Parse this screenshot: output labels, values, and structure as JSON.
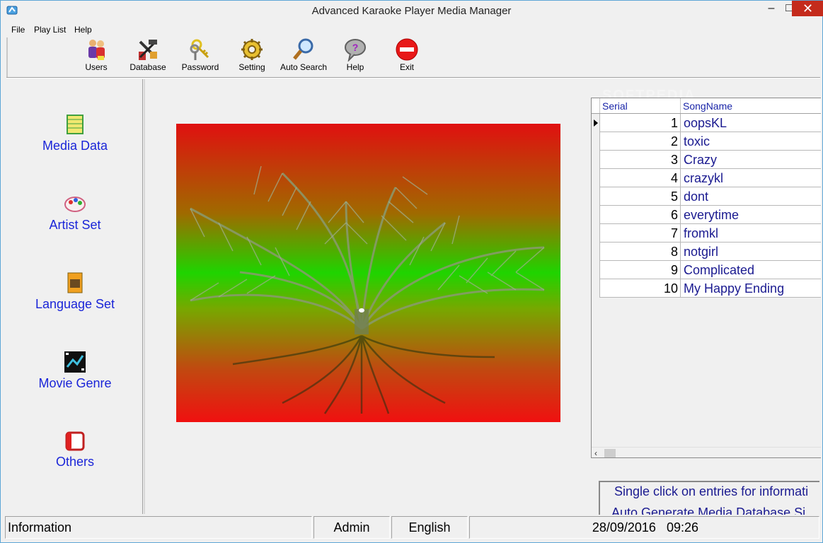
{
  "window": {
    "title": "Advanced Karaoke Player Media Manager",
    "controls": {
      "minimize": "–",
      "maximize": "□",
      "close": "✕"
    }
  },
  "menubar": [
    {
      "label": "File"
    },
    {
      "label": "Play List"
    },
    {
      "label": "Help"
    }
  ],
  "toolbar": [
    {
      "label": "Users",
      "icon": "users-icon"
    },
    {
      "label": "Database",
      "icon": "database-tools-icon"
    },
    {
      "label": "Password",
      "icon": "keys-icon"
    },
    {
      "label": "Setting",
      "icon": "gear-icon"
    },
    {
      "label": "Auto Search",
      "icon": "magnifier-icon"
    },
    {
      "label": "Help",
      "icon": "help-icon"
    },
    {
      "label": "Exit",
      "icon": "exit-icon"
    }
  ],
  "sidebar": [
    {
      "label": "Media Data",
      "icon": "media-data-icon"
    },
    {
      "label": "Artist Set",
      "icon": "artist-set-icon"
    },
    {
      "label": "Language Set",
      "icon": "language-set-icon"
    },
    {
      "label": "Movie Genre",
      "icon": "movie-genre-icon"
    },
    {
      "label": "Others",
      "icon": "others-icon"
    }
  ],
  "grid": {
    "columns": [
      "Serial",
      "SongName"
    ],
    "rows": [
      {
        "serial": "1",
        "song": "oopsKL"
      },
      {
        "serial": "2",
        "song": "toxic"
      },
      {
        "serial": "3",
        "song": "Crazy"
      },
      {
        "serial": "4",
        "song": "crazykl"
      },
      {
        "serial": "5",
        "song": "dont"
      },
      {
        "serial": "6",
        "song": "everytime"
      },
      {
        "serial": "7",
        "song": "fromkl"
      },
      {
        "serial": "8",
        "song": "notgirl"
      },
      {
        "serial": "9",
        "song": "Complicated"
      },
      {
        "serial": "10",
        "song": "My Happy Ending"
      }
    ],
    "scroll_left": "‹"
  },
  "watermark": "SOFTPEDIA",
  "info": {
    "line1": "Single click on entries for informati",
    "line2": "Auto Generate Media Database Si"
  },
  "status": {
    "info": "Information",
    "user": "Admin",
    "language": "English",
    "date": "28/09/2016",
    "time": "09:26"
  },
  "colors": {
    "link_blue": "#1a25d8",
    "close_red": "#c42b1c"
  }
}
